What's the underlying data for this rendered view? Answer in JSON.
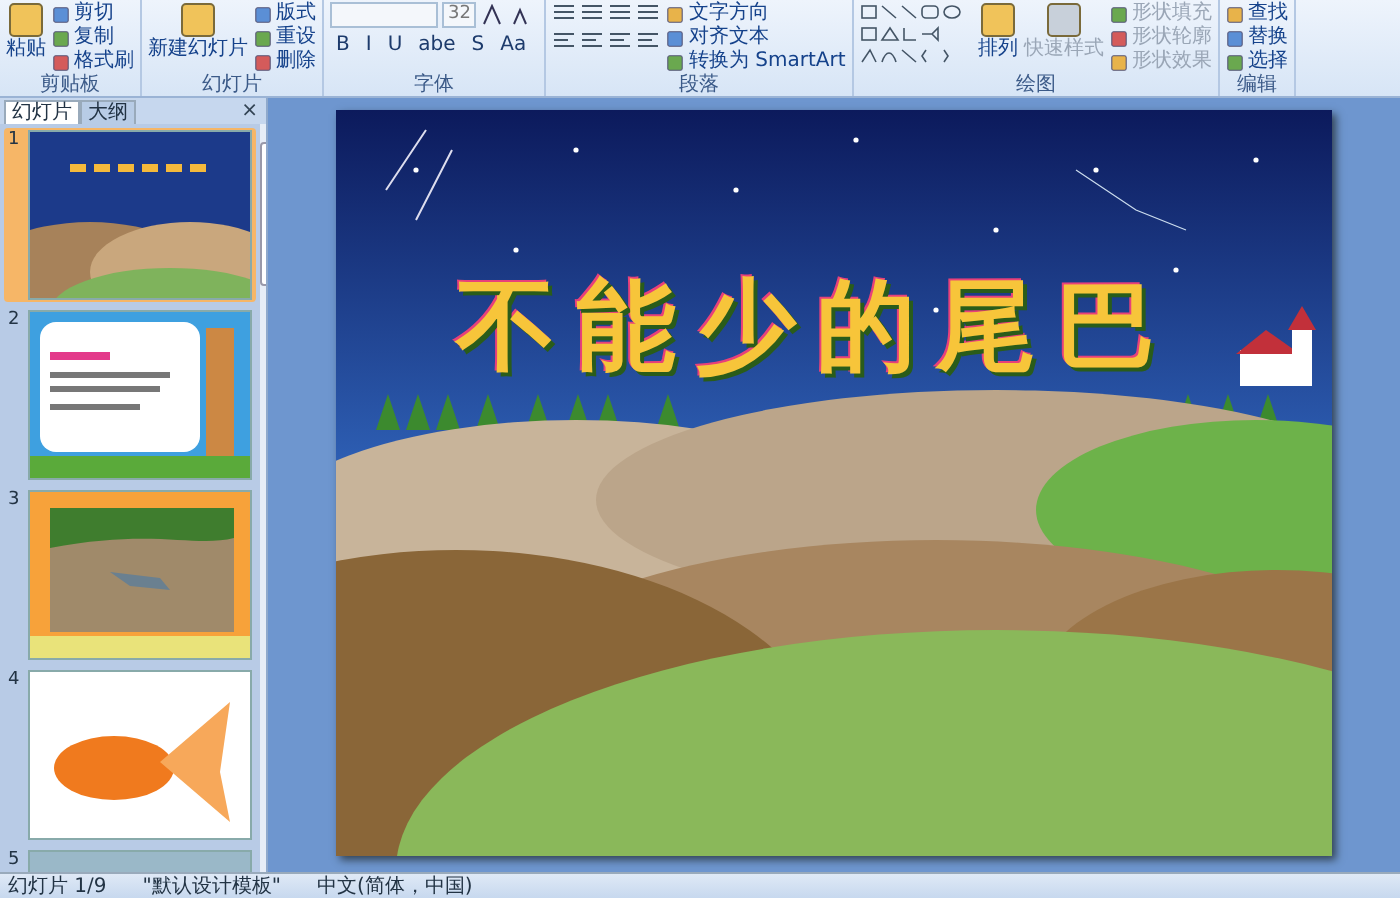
{
  "ribbon": {
    "groups": [
      {
        "label": "剪贴板",
        "kind": "clipboard",
        "items": [
          {
            "label": "粘贴",
            "kind": "large",
            "disabled": false
          },
          {
            "label": "剪切",
            "kind": "small",
            "disabled": false
          },
          {
            "label": "复制",
            "kind": "small",
            "disabled": false
          },
          {
            "label": "格式刷",
            "kind": "small",
            "disabled": false
          }
        ]
      },
      {
        "label": "幻灯片",
        "kind": "slides",
        "items": [
          {
            "label": "新建幻灯片",
            "kind": "large",
            "disabled": false
          },
          {
            "label": "版式",
            "kind": "small",
            "disabled": false
          },
          {
            "label": "重设",
            "kind": "small",
            "disabled": false
          },
          {
            "label": "删除",
            "kind": "small",
            "disabled": false
          }
        ]
      },
      {
        "label": "字体",
        "kind": "font",
        "font_size": "32",
        "items": [
          {
            "label": "B",
            "kind": "tool",
            "disabled": false
          },
          {
            "label": "I",
            "kind": "tool",
            "disabled": false
          },
          {
            "label": "U",
            "kind": "tool",
            "disabled": false
          },
          {
            "label": "abe",
            "kind": "tool",
            "disabled": false
          },
          {
            "label": "S",
            "kind": "tool",
            "disabled": false
          },
          {
            "label": "Aa",
            "kind": "tool",
            "disabled": false
          }
        ]
      },
      {
        "label": "段落",
        "kind": "paragraph",
        "items": [
          {
            "label": "文字方向",
            "kind": "small",
            "disabled": false
          },
          {
            "label": "对齐文本",
            "kind": "small",
            "disabled": false
          },
          {
            "label": "转换为 SmartArt",
            "kind": "small",
            "disabled": false
          }
        ]
      },
      {
        "label": "绘图",
        "kind": "drawing",
        "items": [
          {
            "label": "排列",
            "kind": "large",
            "disabled": false
          },
          {
            "label": "快速样式",
            "kind": "large",
            "disabled": true
          },
          {
            "label": "形状填充",
            "kind": "small",
            "disabled": true
          },
          {
            "label": "形状轮廓",
            "kind": "small",
            "disabled": true
          },
          {
            "label": "形状效果",
            "kind": "small",
            "disabled": true
          }
        ]
      },
      {
        "label": "编辑",
        "kind": "editing",
        "items": [
          {
            "label": "查找",
            "kind": "small",
            "disabled": false
          },
          {
            "label": "替换",
            "kind": "small",
            "disabled": false
          },
          {
            "label": "选择",
            "kind": "small",
            "disabled": false
          }
        ]
      }
    ]
  },
  "panel": {
    "tabs": [
      {
        "label": "幻灯片",
        "selected": true
      },
      {
        "label": "大纲",
        "selected": false
      }
    ],
    "close": "×",
    "thumbnails": [
      {
        "number": "1",
        "kind": "landscape",
        "selected": true
      },
      {
        "number": "2",
        "kind": "objectives",
        "selected": false
      },
      {
        "number": "3",
        "kind": "wall",
        "selected": false
      },
      {
        "number": "4",
        "kind": "goldfish",
        "selected": false
      },
      {
        "number": "5",
        "kind": "scenery",
        "selected": false
      }
    ]
  },
  "slide": {
    "title": "不能少的尾巴"
  },
  "status_bar": {
    "slide": "幻灯片 1/9",
    "theme": "\"默认设计模板\"",
    "language": "中文(简体，中国)"
  }
}
